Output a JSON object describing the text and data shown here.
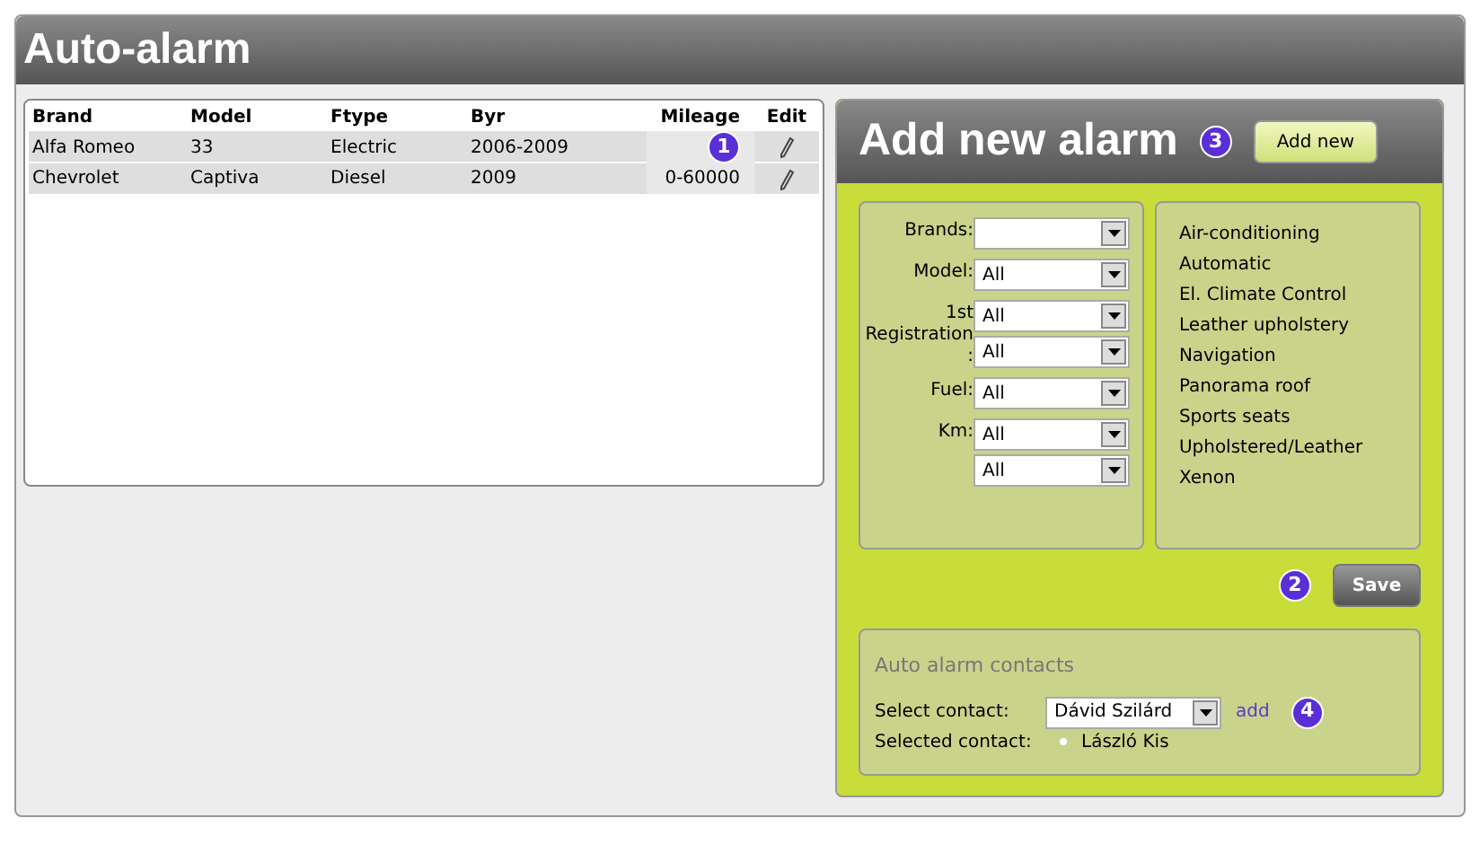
{
  "window": {
    "title": "Auto-alarm"
  },
  "table": {
    "columns": [
      "Brand",
      "Model",
      "Ftype",
      "Byr",
      "Mileage",
      "Edit"
    ],
    "rows": [
      {
        "cells": [
          "Alfa Romeo",
          "33",
          "Electric",
          "2006-2009"
        ],
        "badge": "1"
      },
      {
        "cells": [
          "Chevrolet",
          "Captiva",
          "Diesel",
          "2009",
          "0-60000"
        ]
      }
    ]
  },
  "panel": {
    "title": "Add new alarm",
    "badge": "3",
    "add_button": "Add new",
    "filters": [
      {
        "label": "Brands:",
        "blank_select": true
      },
      {
        "label": "Model:",
        "selects": [
          {
            "value": "All"
          }
        ]
      },
      {
        "label": "1st Registration :",
        "selects": [
          {
            "value": "All"
          },
          {
            "value": "All"
          }
        ]
      },
      {
        "label": "Fuel:",
        "selects": [
          {
            "value": "All"
          }
        ]
      },
      {
        "label": "Km:",
        "selects": [
          {
            "value": "All"
          },
          {
            "value": "All"
          }
        ]
      }
    ],
    "features": [
      "Air-conditioning",
      "Automatic",
      "El. Climate Control",
      "Leather upholstery",
      "Navigation",
      "Panorama roof",
      "Sports seats",
      "Upholstered/Leather",
      "Xenon"
    ],
    "save_button": "Save",
    "save_badge": "2",
    "contacts": {
      "title": "Auto alarm contacts",
      "select_label": "Select contact:",
      "select_value": "Dávid Szilárd",
      "add_link": "add",
      "badge": "4",
      "selected_label": "Selected contact:",
      "selected": [
        "László Kis"
      ]
    }
  }
}
